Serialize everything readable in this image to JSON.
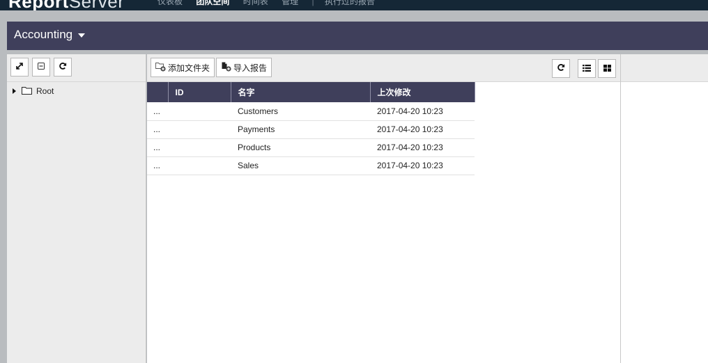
{
  "app": {
    "brand_bold": "Report",
    "brand_light": "Server"
  },
  "topnav": {
    "items": [
      "仪表板",
      "团队空间",
      "时间表",
      "管理"
    ],
    "active_index": 1,
    "last_item": "执行过的报告"
  },
  "title": {
    "label": "Accounting"
  },
  "tree": {
    "root_label": "Root"
  },
  "toolbar": {
    "add_folder_label": "添加文件夹",
    "import_report_label": "导入报告"
  },
  "table": {
    "columns": [
      "",
      "ID",
      "名字",
      "上次修改"
    ],
    "rows": [
      {
        "menu": "...",
        "id": "",
        "name": "Customers",
        "modified": "2017-04-20 10:23"
      },
      {
        "menu": "...",
        "id": "",
        "name": "Payments",
        "modified": "2017-04-20 10:23"
      },
      {
        "menu": "...",
        "id": "",
        "name": "Products",
        "modified": "2017-04-20 10:23"
      },
      {
        "menu": "...",
        "id": "",
        "name": "Sales",
        "modified": "2017-04-20 10:23"
      }
    ]
  },
  "colors": {
    "topbar": "#152736",
    "titlebar": "#3f3f5b",
    "table_header": "#3f3f5b",
    "panel_bg": "#ececec",
    "frame_bg": "#b9bcbf"
  },
  "icons": {
    "expand": "expand-icon",
    "collapse": "collapse-icon",
    "refresh": "refresh-icon",
    "folder": "folder-icon",
    "list_view": "list-view-icon",
    "grid_view": "grid-view-icon"
  }
}
